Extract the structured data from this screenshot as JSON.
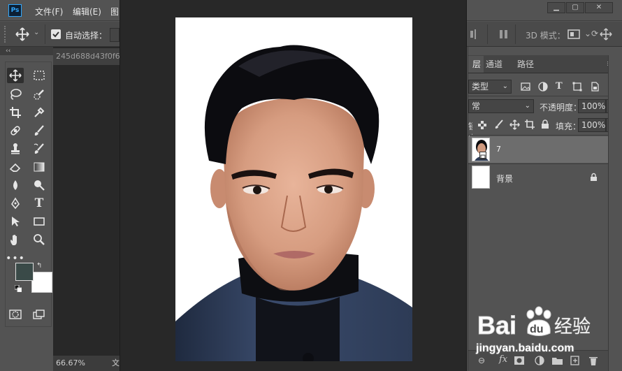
{
  "app": {
    "logo_text": "Ps"
  },
  "menu": [
    "文件(F)",
    "编辑(E)",
    "图"
  ],
  "options": {
    "auto_select_label": "自动选择：",
    "mode3d_label": "3D 模式："
  },
  "document": {
    "tab_title": "245d688d43f0f6",
    "zoom": "66.67%",
    "status_text": "文"
  },
  "panel_tabs": [
    "层",
    "通道",
    "路径"
  ],
  "layers": {
    "filter_label": "类型",
    "blend_mode": "常",
    "opacity_label": "不透明度：",
    "opacity_value": "100%",
    "lock_label": "锁定：",
    "fill_label": "填充：",
    "fill_value": "100%",
    "items": [
      {
        "name": "7",
        "selected": true
      },
      {
        "name": "背景",
        "locked": true
      }
    ]
  },
  "colors": {
    "foreground": "#3a4a48",
    "background": "#ffffff",
    "accent": "#31a8ff"
  },
  "watermark": {
    "brand": "Bai",
    "paw": "du",
    "suffix": "经验",
    "url": "jingyan.baidu.com"
  }
}
